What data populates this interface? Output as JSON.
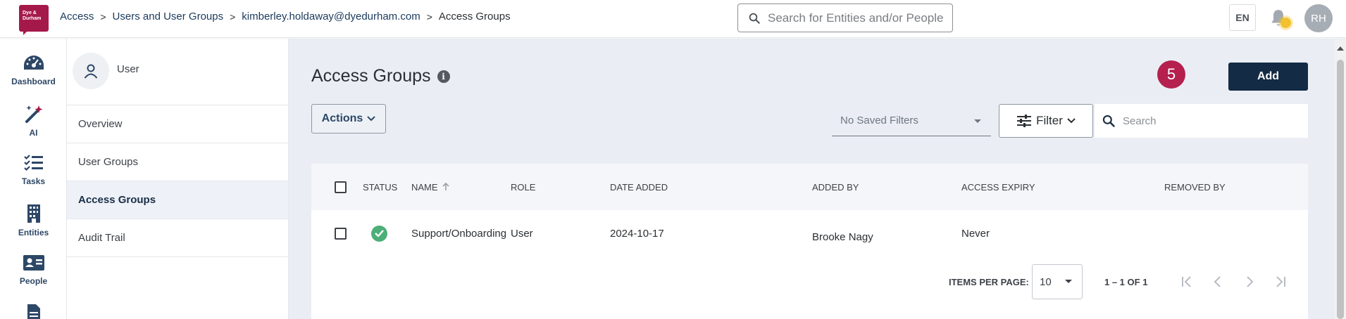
{
  "header": {
    "logo_text": "Dye & Durham",
    "breadcrumb": [
      "Access",
      "Users and User Groups",
      "kimberley.holdaway@dyedurham.com",
      "Access Groups"
    ],
    "breadcrumb_separator": ">",
    "search_placeholder": "Search for Entities and/or People",
    "language": "EN",
    "avatar_initials": "RH"
  },
  "rail": {
    "items": [
      {
        "label": "Dashboard",
        "icon": "dashboard-gauge-icon"
      },
      {
        "label": "AI",
        "icon": "magic-wand-icon"
      },
      {
        "label": "Tasks",
        "icon": "checklist-icon"
      },
      {
        "label": "Entities",
        "icon": "building-icon"
      },
      {
        "label": "People",
        "icon": "id-card-icon"
      }
    ]
  },
  "subnav": {
    "user_label": "User",
    "items": [
      {
        "label": "Overview",
        "active": false
      },
      {
        "label": "User Groups",
        "active": false
      },
      {
        "label": "Access Groups",
        "active": true
      },
      {
        "label": "Audit Trail",
        "active": false
      }
    ]
  },
  "main": {
    "title": "Access Groups",
    "step_badge": "5",
    "add_label": "Add",
    "actions_label": "Actions",
    "saved_filters_placeholder": "No Saved Filters",
    "filter_label": "Filter",
    "search_placeholder": "Search"
  },
  "table": {
    "columns": [
      "STATUS",
      "NAME",
      "ROLE",
      "DATE ADDED",
      "ADDED BY",
      "ACCESS EXPIRY",
      "REMOVED BY"
    ],
    "sort_column": "NAME",
    "rows": [
      {
        "status": "active",
        "name": "Support/Onboarding",
        "role": "User",
        "date_added": "2024-10-17",
        "added_by": "Brooke Nagy",
        "access_expiry": "Never",
        "removed_by": ""
      }
    ]
  },
  "paginator": {
    "items_per_page_label": "ITEMS PER PAGE:",
    "items_per_page_value": "10",
    "range_label": "1 – 1 OF 1"
  },
  "colors": {
    "brand": "#a5194a",
    "primary_button": "#132b44",
    "badge": "#b5204f",
    "status_ok": "#4caf78",
    "main_bg": "#eaeef4"
  }
}
